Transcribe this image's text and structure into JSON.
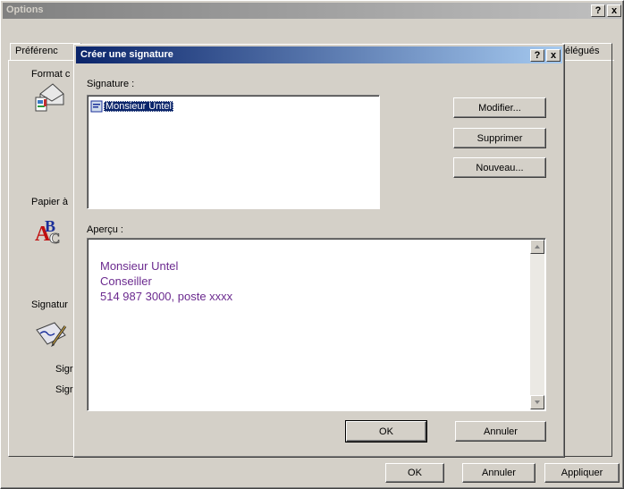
{
  "options_window": {
    "title": "Options",
    "help_btn": "?",
    "close_btn": "x",
    "tabs": [
      "Préférenc",
      "élégués"
    ],
    "section_format": "Format c",
    "section_papier": "Papier à",
    "section_signature": "Signatur",
    "sig_label_1": "Sigr",
    "sig_label_2": "Sigr",
    "ok": "OK",
    "annuler": "Annuler",
    "appliquer": "Appliquer"
  },
  "dialog": {
    "title": "Créer une signature",
    "help_btn": "?",
    "close_btn": "x",
    "signature_label": "Signature :",
    "signatures": [
      "Monsieur Untel"
    ],
    "modifier": "Modifier...",
    "supprimer": "Supprimer",
    "nouveau": "Nouveau...",
    "apercu_label": "Aperçu :",
    "preview_lines": [
      "Monsieur Untel",
      "Conseiller",
      "514 987 3000, poste xxxx"
    ],
    "ok": "OK",
    "annuler": "Annuler"
  },
  "colors": {
    "preview_text": "#6b2a8f",
    "title_active_start": "#0a246a",
    "title_active_end": "#a6caf0",
    "title_inactive_start": "#808080",
    "title_inactive_end": "#c0c0c0"
  }
}
